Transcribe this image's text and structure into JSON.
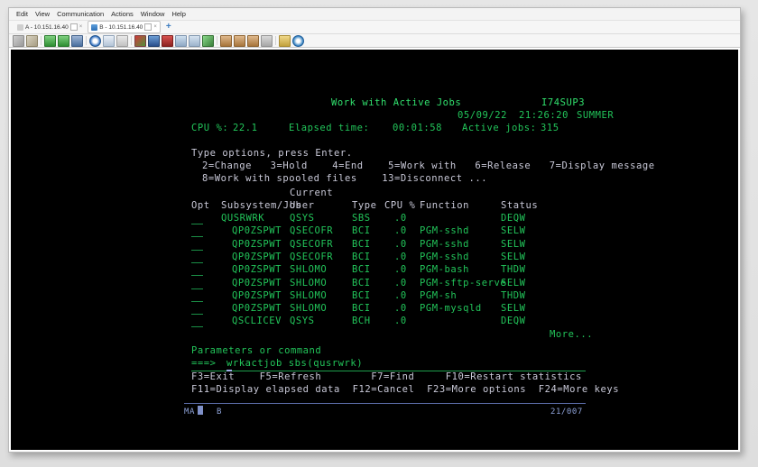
{
  "window": {
    "menus": [
      "Edit",
      "View",
      "Communication",
      "Actions",
      "Window",
      "Help"
    ],
    "tabs": [
      {
        "label": "A - 10.151.16.40",
        "active": false
      },
      {
        "label": "B - 10.151.16.40",
        "active": true
      }
    ],
    "new_tab_label": "+",
    "close_label": "×",
    "toolbar_icons": [
      "copy-icon",
      "paste-icon",
      "send-file-icon",
      "receive-file-icon",
      "save-icon",
      "record-icon",
      "display-icon",
      "print-screen-icon",
      "color-mapping-icon",
      "security-icon",
      "keypad-icon",
      "keyboard-icon",
      "window-setup-icon",
      "macro-icon",
      "transfer-up-icon",
      "transfer-down-icon",
      "transfer-list-icon",
      "transfer-edit-icon",
      "lock-icon",
      "help-icon"
    ]
  },
  "terminal": {
    "title": "Work with Active Jobs",
    "system": "I74SUP3",
    "date": "05/09/22",
    "time": "21:26:20",
    "timezone": "SUMMER",
    "stats": {
      "cpu_label": "CPU %:",
      "cpu_value": "22.1",
      "elapsed_label": "Elapsed time:",
      "elapsed_value": "00:01:58",
      "jobs_label": "Active jobs:",
      "jobs_value": "315"
    },
    "prompt_line": "Type options, press Enter.",
    "options_line_1": "2=Change   3=Hold    4=End    5=Work with   6=Release   7=Display message",
    "options_line_2": "8=Work with spooled files    13=Disconnect ...",
    "headers": {
      "current": "Current",
      "opt": "Opt",
      "subsystem_job": "Subsystem/Job",
      "user": "User",
      "type": "Type",
      "cpu": "CPU %",
      "function": "Function",
      "status": "Status"
    },
    "rows": [
      {
        "indent": 0,
        "job": "QUSRWRK",
        "user": "QSYS",
        "type": "SBS",
        "cpu": ".0",
        "function": "",
        "status": "DEQW"
      },
      {
        "indent": 1,
        "job": "QP0ZSPWT",
        "user": "QSECOFR",
        "type": "BCI",
        "cpu": ".0",
        "function": "PGM-sshd",
        "status": "SELW"
      },
      {
        "indent": 1,
        "job": "QP0ZSPWT",
        "user": "QSECOFR",
        "type": "BCI",
        "cpu": ".0",
        "function": "PGM-sshd",
        "status": "SELW"
      },
      {
        "indent": 1,
        "job": "QP0ZSPWT",
        "user": "QSECOFR",
        "type": "BCI",
        "cpu": ".0",
        "function": "PGM-sshd",
        "status": "SELW"
      },
      {
        "indent": 1,
        "job": "QP0ZSPWT",
        "user": "SHLOMO",
        "type": "BCI",
        "cpu": ".0",
        "function": "PGM-bash",
        "status": "THDW"
      },
      {
        "indent": 1,
        "job": "QP0ZSPWT",
        "user": "SHLOMO",
        "type": "BCI",
        "cpu": ".0",
        "function": "PGM-sftp-serve",
        "status": "SELW"
      },
      {
        "indent": 1,
        "job": "QP0ZSPWT",
        "user": "SHLOMO",
        "type": "BCI",
        "cpu": ".0",
        "function": "PGM-sh",
        "status": "THDW"
      },
      {
        "indent": 1,
        "job": "QP0ZSPWT",
        "user": "SHLOMO",
        "type": "BCI",
        "cpu": ".0",
        "function": "PGM-mysqld",
        "status": "SELW"
      },
      {
        "indent": 1,
        "job": "QSCLICEV",
        "user": "QSYS",
        "type": "BCH",
        "cpu": ".0",
        "function": "",
        "status": "DEQW"
      }
    ],
    "more": "More...",
    "param_label": "Parameters or command",
    "command_prefix": "===>",
    "command_value": "wrkactjob sbs(qusrwrk)",
    "fkeys_line_1": "F3=Exit    F5=Refresh        F7=Find     F10=Restart statistics",
    "fkeys_line_2": "F11=Display elapsed data  F12=Cancel  F23=More options  F24=More keys",
    "status_bar": {
      "indicator": "MA",
      "session": "B",
      "position": "21/007"
    }
  }
}
